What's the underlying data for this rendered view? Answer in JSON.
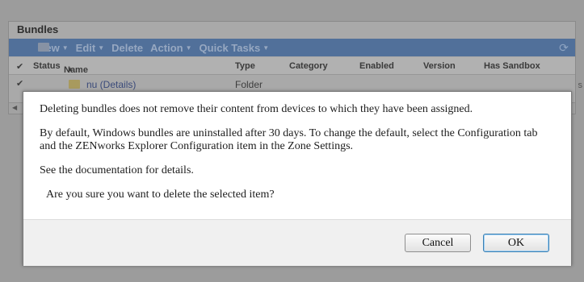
{
  "panel": {
    "title": "Bundles",
    "toolbar": {
      "items": [
        "New",
        "Edit",
        "Delete",
        "Action",
        "Quick Tasks"
      ]
    },
    "columns": [
      "Status",
      "Name",
      "Type",
      "Category",
      "Enabled",
      "Version",
      "Has Sandbox"
    ],
    "rows": [
      {
        "name": "nu  (Details)",
        "type": "Folder"
      }
    ],
    "partial_right_text": "s"
  },
  "dialog": {
    "message_1": "Deleting bundles does not remove their content from devices to which they have been assigned.",
    "message_2": "By default, Windows bundles are uninstalled after 30 days. To change the default, select the Configuration tab and the ZENworks Explorer Configuration item in the Zone Settings.",
    "message_3": "See the documentation for details.",
    "question": "Are you sure you want to delete the selected item?",
    "cancel_label": "Cancel",
    "ok_label": "OK"
  },
  "colors": {
    "toolbar_bg": "#51709a",
    "overlay": "#9c9c9c",
    "ok_focus": "#3c7fb1"
  }
}
